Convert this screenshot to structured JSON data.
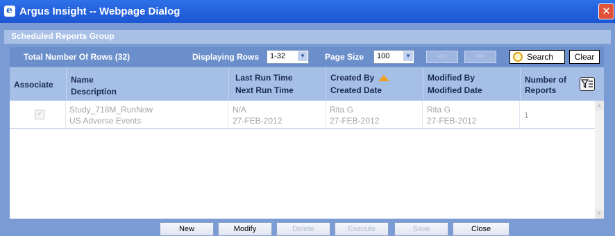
{
  "window": {
    "title": "Argus Insight -- Webpage Dialog",
    "close_symbol": "✕",
    "app_icon": "ie-icon"
  },
  "group": {
    "title": "Scheduled Reports Group"
  },
  "toolbar": {
    "total_rows": "Total Number Of Rows (32)",
    "displaying_label": "Displaying Rows",
    "displaying_value": "1-32",
    "page_size_label": "Page Size",
    "page_size_value": "100",
    "prev_label": "<<",
    "next_label": ">>",
    "search_label": "Search",
    "clear_label": "Clear"
  },
  "grid": {
    "headers": {
      "associate": "Associate",
      "name": "Name",
      "description": "Description",
      "last_run": "Last Run Time",
      "next_run": "Next Run Time",
      "created_by": "Created By",
      "created_date": "Created Date",
      "modified_by": "Modified By",
      "modified_date": "Modified Date",
      "num_reports_1": "Number of",
      "num_reports_2": "Reports"
    },
    "rows": [
      {
        "associate_checked": true,
        "name": "Study_718M_RunNow",
        "description": "US Adverse Events",
        "last_run": "N/A",
        "next_run": "27-FEB-2012",
        "created_by": "Rita G",
        "created_date": "27-FEB-2012",
        "modified_by": "Rita G",
        "modified_date": "27-FEB-2012",
        "num_reports": "1"
      }
    ]
  },
  "actions": {
    "new": "New",
    "modify": "Modify",
    "delete": "Delete",
    "execute": "Execute",
    "save": "Save",
    "close": "Close"
  },
  "colors": {
    "titlebar": "#2563df",
    "frame": "#7a9bd3",
    "grid_header": "#a5bfe7",
    "sort_arrow": "#f0a020",
    "disabled_text": "#a5a5a5"
  }
}
